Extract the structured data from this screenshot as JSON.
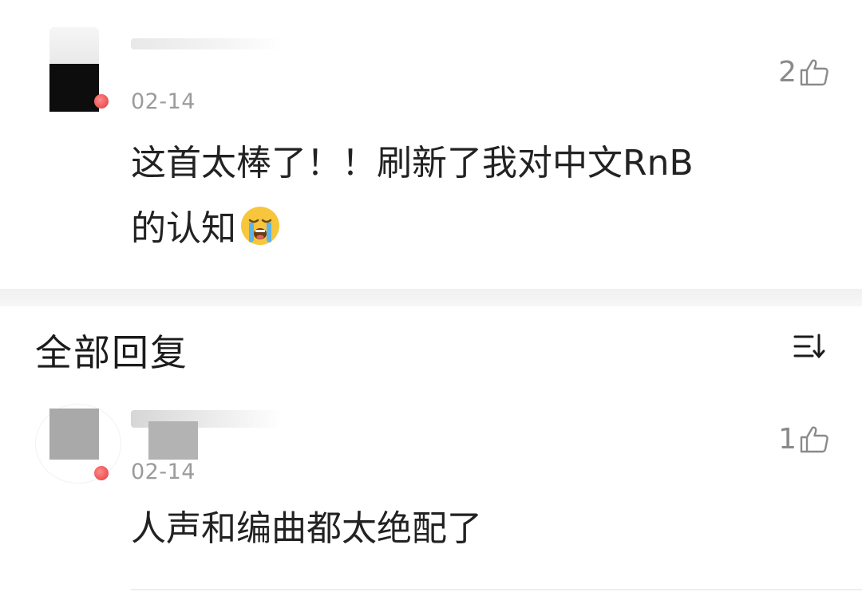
{
  "main_comment": {
    "date": "02-14",
    "likes": "2",
    "text_line1": "这首太棒了！！刷新了我对中文RnB",
    "text_line2": "的认知",
    "emoji_icon": "loudly-crying-face-icon"
  },
  "replies_section": {
    "title": "全部回复",
    "sort_icon": "sort-icon"
  },
  "reply": {
    "date": "02-14",
    "likes": "1",
    "text": "人声和编曲都太绝配了"
  },
  "colors": {
    "text_primary": "#222222",
    "text_secondary": "#9b9b9b",
    "vip_badge": "#e33a3a",
    "divider": "#f0f0f0"
  }
}
